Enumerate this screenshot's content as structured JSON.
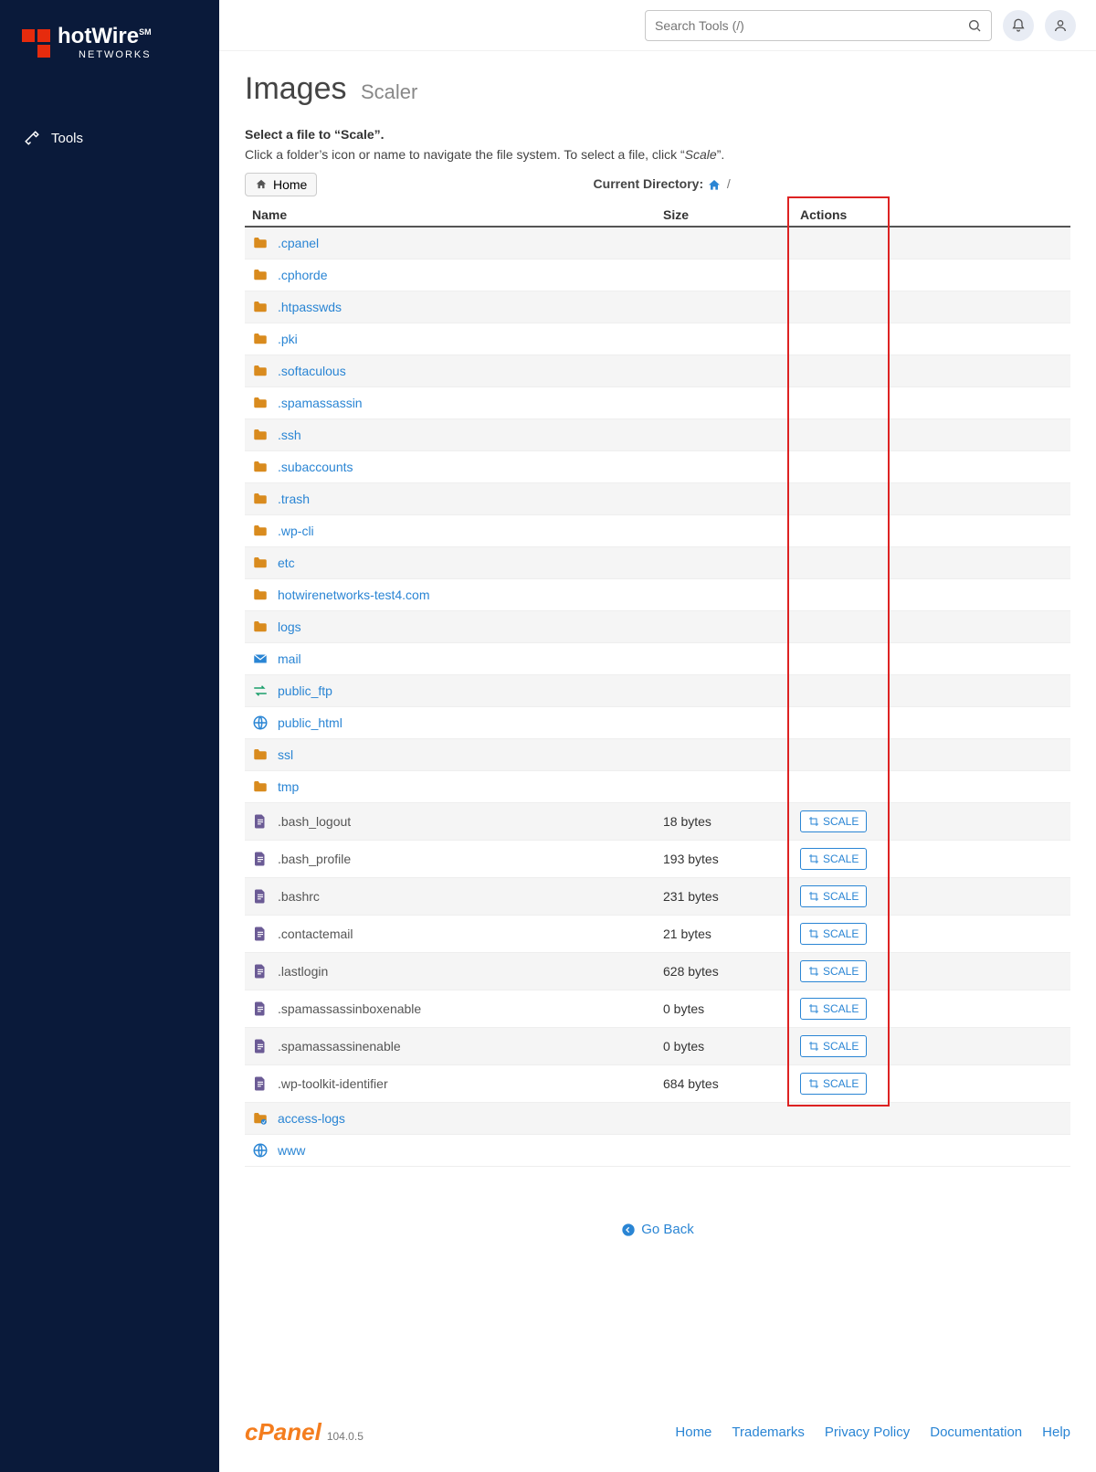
{
  "brand": {
    "name": "hotWire",
    "sub": "NETWORKS",
    "sm": "SM"
  },
  "sidebar": {
    "items": [
      {
        "label": "Tools"
      }
    ]
  },
  "topbar": {
    "search_placeholder": "Search Tools (/)"
  },
  "page": {
    "title": "Images",
    "subtitle": "Scaler",
    "instruction_bold": "Select a file to “Scale”.",
    "instruction_light_prefix": "Click a folder’s icon or name to navigate the file system. To select a file, click “",
    "instruction_light_em": "Scale",
    "instruction_light_suffix": "”.",
    "home_label": "Home",
    "current_dir_label": "Current Directory:",
    "current_dir_slash": "/",
    "go_back": "Go Back"
  },
  "columns": {
    "name": "Name",
    "size": "Size",
    "actions": "Actions"
  },
  "scale_label": "SCALE",
  "rows": [
    {
      "type": "folder",
      "name": ".cpanel"
    },
    {
      "type": "folder",
      "name": ".cphorde"
    },
    {
      "type": "folder",
      "name": ".htpasswds"
    },
    {
      "type": "folder",
      "name": ".pki"
    },
    {
      "type": "folder",
      "name": ".softaculous"
    },
    {
      "type": "folder",
      "name": ".spamassassin"
    },
    {
      "type": "folder",
      "name": ".ssh"
    },
    {
      "type": "folder",
      "name": ".subaccounts"
    },
    {
      "type": "folder",
      "name": ".trash"
    },
    {
      "type": "folder",
      "name": ".wp-cli"
    },
    {
      "type": "folder",
      "name": "etc"
    },
    {
      "type": "folder",
      "name": "hotwirenetworks-test4.com"
    },
    {
      "type": "folder",
      "name": "logs"
    },
    {
      "type": "mail",
      "name": "mail"
    },
    {
      "type": "ftp",
      "name": "public_ftp"
    },
    {
      "type": "globe",
      "name": "public_html"
    },
    {
      "type": "folder",
      "name": "ssl"
    },
    {
      "type": "folder",
      "name": "tmp"
    },
    {
      "type": "file",
      "name": ".bash_logout",
      "size": "18 bytes",
      "scale": true
    },
    {
      "type": "file",
      "name": ".bash_profile",
      "size": "193 bytes",
      "scale": true
    },
    {
      "type": "file",
      "name": ".bashrc",
      "size": "231 bytes",
      "scale": true
    },
    {
      "type": "file",
      "name": ".contactemail",
      "size": "21 bytes",
      "scale": true
    },
    {
      "type": "file",
      "name": ".lastlogin",
      "size": "628 bytes",
      "scale": true
    },
    {
      "type": "file",
      "name": ".spamassassinboxenable",
      "size": "0 bytes",
      "scale": true
    },
    {
      "type": "file",
      "name": ".spamassassinenable",
      "size": "0 bytes",
      "scale": true
    },
    {
      "type": "file",
      "name": ".wp-toolkit-identifier",
      "size": "684 bytes",
      "scale": true
    },
    {
      "type": "shortcut",
      "name": "access-logs"
    },
    {
      "type": "globe",
      "name": "www"
    }
  ],
  "footer": {
    "brand": "cPanel",
    "version": "104.0.5",
    "links": [
      {
        "label": "Home"
      },
      {
        "label": "Trademarks"
      },
      {
        "label": "Privacy Policy"
      },
      {
        "label": "Documentation"
      },
      {
        "label": "Help"
      }
    ]
  }
}
